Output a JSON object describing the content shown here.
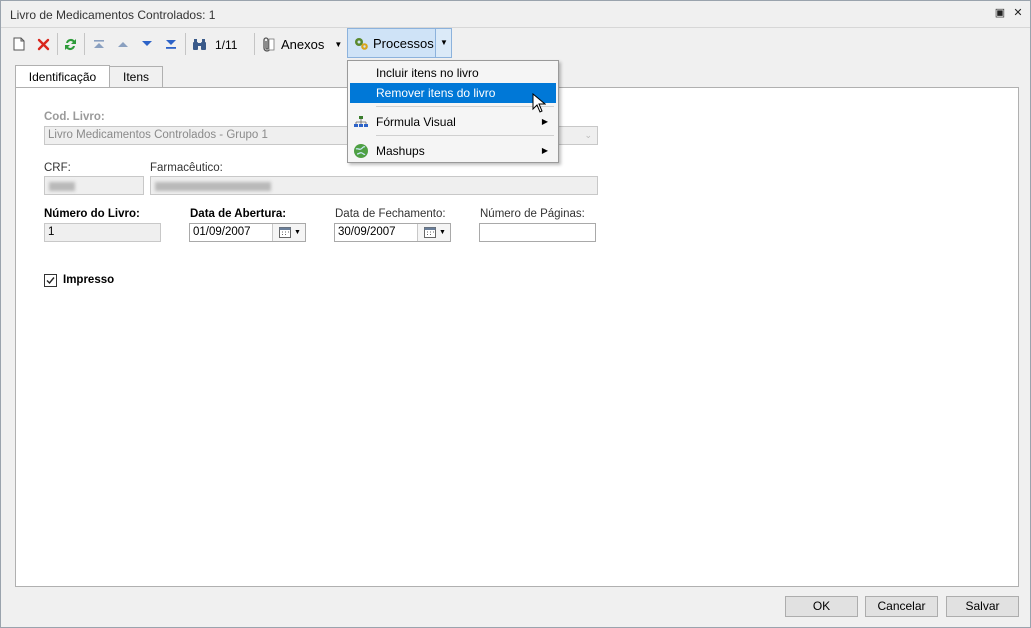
{
  "window": {
    "title": "Livro de Medicamentos Controlados: 1",
    "restore_glyph": "▣",
    "close_glyph": "✕"
  },
  "toolbar": {
    "record_position": "1/11",
    "anexos_label": "Anexos",
    "processos_label": "Processos"
  },
  "tabs": [
    {
      "label": "Identificação",
      "active": true
    },
    {
      "label": "Itens",
      "active": false
    }
  ],
  "form": {
    "cod_livro_label": "Cod. Livro:",
    "cod_livro_value": "Livro Medicamentos Controlados - Grupo 1",
    "crf_label": "CRF:",
    "farmaceutico_label": "Farmacêutico:",
    "numero_livro_label": "Número do Livro:",
    "numero_livro_value": "1",
    "data_abertura_label": "Data de Abertura:",
    "data_abertura_value": "01/09/2007",
    "data_fechamento_label": "Data de Fechamento:",
    "data_fechamento_value": "30/09/2007",
    "numero_paginas_label": "Número de Páginas:",
    "numero_paginas_value": "",
    "impresso_label": "Impresso",
    "impresso_checked": true
  },
  "processos_menu": {
    "items": [
      {
        "label": "Incluir itens no livro"
      },
      {
        "label": "Remover itens do livro"
      },
      {
        "label": "Fórmula Visual"
      },
      {
        "label": "Mashups"
      }
    ]
  },
  "footer": {
    "ok_label": "OK",
    "cancel_label": "Cancelar",
    "save_label": "Salvar"
  },
  "colors": {
    "highlight": "#0078d7",
    "delete_red": "#d9261c",
    "refresh_green": "#2e9b3a",
    "nav_blue": "#2d63c8"
  }
}
